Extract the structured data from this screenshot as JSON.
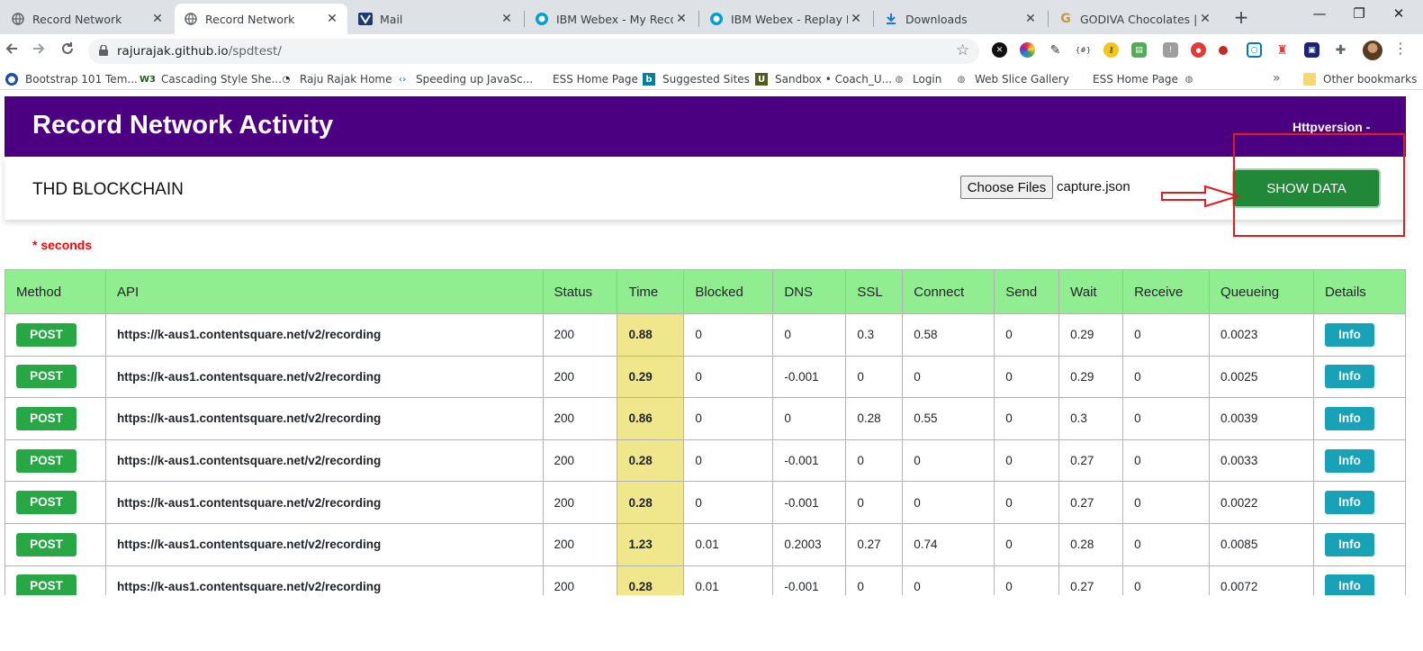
{
  "browser": {
    "tabs": [
      {
        "title": "Record Network",
        "icon": "globe-icon",
        "active": false
      },
      {
        "title": "Record Network",
        "icon": "globe-icon",
        "active": true
      },
      {
        "title": "Mail",
        "icon": "mail-icon",
        "active": false
      },
      {
        "title": "IBM Webex - My Record",
        "icon": "webex-icon",
        "active": false
      },
      {
        "title": "IBM Webex - Replay Rec",
        "icon": "webex-icon",
        "active": false
      },
      {
        "title": "Downloads",
        "icon": "download-icon",
        "active": false
      },
      {
        "title": "GODIVA Chocolates | Go",
        "icon": "google-icon",
        "active": false
      }
    ],
    "tab_close_glyph": "✕",
    "new_tab_glyph": "+",
    "window_controls": {
      "minimize": "—",
      "restore": "❐",
      "close": "✕"
    },
    "url": {
      "host": "rajurajak.github.io",
      "path": "/spdtest/"
    },
    "bookmarks": [
      {
        "label": "Bootstrap 101 Tem...",
        "icon": "bootstrap-icon"
      },
      {
        "label": "Cascading Style She...",
        "icon": "w3schools-icon"
      },
      {
        "label": "Raju Rajak Home",
        "icon": "home-icon"
      },
      {
        "label": "Speeding up JavaSc...",
        "icon": "google-icon"
      },
      {
        "label": "ESS Home Page",
        "icon": "none"
      },
      {
        "label": "Suggested Sites",
        "icon": "bing-icon"
      },
      {
        "label": "Sandbox • Coach_U...",
        "icon": "sandbox-icon"
      },
      {
        "label": "Login",
        "icon": "globe-icon"
      },
      {
        "label": "Web Slice Gallery",
        "icon": "globe-icon"
      },
      {
        "label": "ESS Home Page",
        "icon": "none"
      }
    ],
    "bookmarks_more": "»",
    "other_bookmarks": "Other bookmarks"
  },
  "app": {
    "title": "Record Network Activity",
    "http_version": "Httpversion -",
    "project_name": "THD BLOCKCHAIN",
    "choose_files_label": "Choose Files",
    "file_name": "capture.json",
    "show_data_label": "SHOW DATA",
    "units_note": "* seconds",
    "colors": {
      "header": "#4b0082",
      "table_header": "#90ee90",
      "time_cell": "#f0e68c",
      "method_badge": "#28a745",
      "info_button": "#17a2b8",
      "show_data": "#218838",
      "annotation": "#e21b1b"
    }
  },
  "table": {
    "headers": [
      "Method",
      "API",
      "Status",
      "Time",
      "Blocked",
      "DNS",
      "SSL",
      "Connect",
      "Send",
      "Wait",
      "Receive",
      "Queueing",
      "Details"
    ],
    "rows": [
      {
        "method": "POST",
        "api": "https://k-aus1.contentsquare.net/v2/recording",
        "status": "200",
        "time": "0.88",
        "blocked": "0",
        "dns": "0",
        "ssl": "0.3",
        "connect": "0.58",
        "send": "0",
        "wait": "0.29",
        "receive": "0",
        "queueing": "0.0023",
        "details": "Info"
      },
      {
        "method": "POST",
        "api": "https://k-aus1.contentsquare.net/v2/recording",
        "status": "200",
        "time": "0.29",
        "blocked": "0",
        "dns": "-0.001",
        "ssl": "0",
        "connect": "0",
        "send": "0",
        "wait": "0.29",
        "receive": "0",
        "queueing": "0.0025",
        "details": "Info"
      },
      {
        "method": "POST",
        "api": "https://k-aus1.contentsquare.net/v2/recording",
        "status": "200",
        "time": "0.86",
        "blocked": "0",
        "dns": "0",
        "ssl": "0.28",
        "connect": "0.55",
        "send": "0",
        "wait": "0.3",
        "receive": "0",
        "queueing": "0.0039",
        "details": "Info"
      },
      {
        "method": "POST",
        "api": "https://k-aus1.contentsquare.net/v2/recording",
        "status": "200",
        "time": "0.28",
        "blocked": "0",
        "dns": "-0.001",
        "ssl": "0",
        "connect": "0",
        "send": "0",
        "wait": "0.27",
        "receive": "0",
        "queueing": "0.0033",
        "details": "Info"
      },
      {
        "method": "POST",
        "api": "https://k-aus1.contentsquare.net/v2/recording",
        "status": "200",
        "time": "0.28",
        "blocked": "0",
        "dns": "-0.001",
        "ssl": "0",
        "connect": "0",
        "send": "0",
        "wait": "0.27",
        "receive": "0",
        "queueing": "0.0022",
        "details": "Info"
      },
      {
        "method": "POST",
        "api": "https://k-aus1.contentsquare.net/v2/recording",
        "status": "200",
        "time": "1.23",
        "blocked": "0.01",
        "dns": "0.2003",
        "ssl": "0.27",
        "connect": "0.74",
        "send": "0",
        "wait": "0.28",
        "receive": "0",
        "queueing": "0.0085",
        "details": "Info"
      },
      {
        "method": "POST",
        "api": "https://k-aus1.contentsquare.net/v2/recording",
        "status": "200",
        "time": "0.28",
        "blocked": "0.01",
        "dns": "-0.001",
        "ssl": "0",
        "connect": "0",
        "send": "0",
        "wait": "0.27",
        "receive": "0",
        "queueing": "0.0072",
        "details": "Info"
      }
    ]
  }
}
